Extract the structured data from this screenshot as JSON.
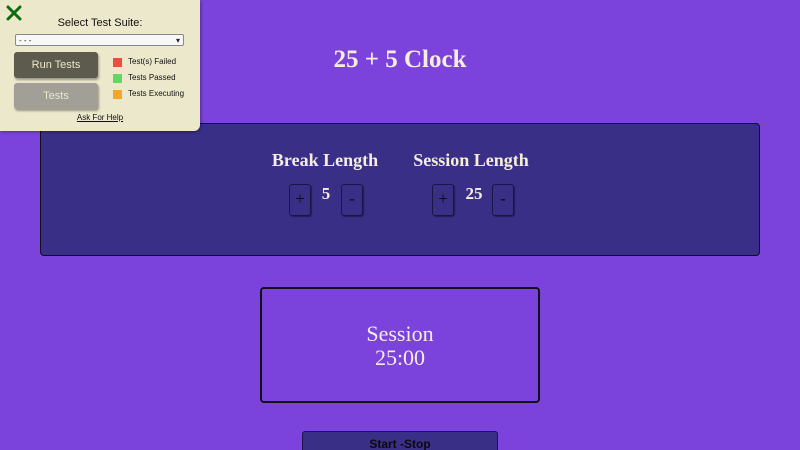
{
  "test_panel": {
    "close_icon": "close-x-icon",
    "title": "Select Test Suite:",
    "select_value": "- - -",
    "run_button": "Run Tests",
    "tests_button": "Tests",
    "legend": [
      {
        "label": "Test(s) Failed",
        "color": "#ef4b3f"
      },
      {
        "label": "Tests Passed",
        "color": "#5fd85f"
      },
      {
        "label": "Tests Executing",
        "color": "#f5a623"
      }
    ],
    "help_link": "Ask For Help"
  },
  "clock": {
    "title": "25 + 5 Clock",
    "break": {
      "label": "Break Length",
      "value": "5",
      "increment": "+",
      "decrement": "-"
    },
    "session": {
      "label": "Session Length",
      "value": "25",
      "increment": "+",
      "decrement": "-"
    },
    "timer_label": "Session",
    "time_left": "25:00",
    "start_stop": "Start -Stop"
  },
  "colors": {
    "background": "#7b43dc",
    "panel": "#3a2f86",
    "text": "#f5eede",
    "test_panel_bg": "#ece8cc"
  }
}
